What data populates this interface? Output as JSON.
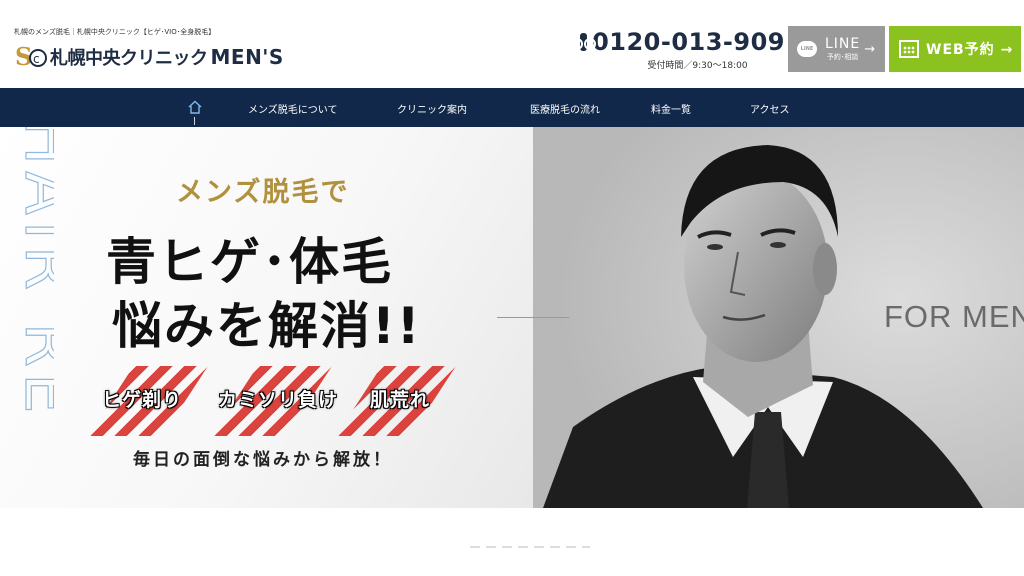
{
  "header": {
    "tagline": "札幌のメンズ脱毛｜札幌中央クリニック【ヒゲ･VIO･全身脱毛】",
    "logo_text": "札幌中央クリニック",
    "logo_suffix": "MEN'S",
    "phone_number": "0120-013-909",
    "phone_hours": "受付時間／9:30～18:00",
    "line_button": {
      "badge": "LINE",
      "label": "LINE",
      "sub": "予約･相談",
      "arrow": "→"
    },
    "web_button": {
      "label": "WEB予約",
      "arrow": "→"
    }
  },
  "nav": {
    "home_icon": "home-icon",
    "items": [
      {
        "label": "メンズ脱毛について"
      },
      {
        "label": "クリニック案内"
      },
      {
        "label": "医療脱毛の流れ"
      },
      {
        "label": "料金一覧"
      },
      {
        "label": "アクセス"
      }
    ]
  },
  "hero": {
    "subtitle": "メンズ脱毛で",
    "title_line1": "青ヒゲ･体毛",
    "title_line2": "悩みを解消!!",
    "troubles": [
      "ヒゲ剃り",
      "カミソリ負け",
      "肌荒れ"
    ],
    "note": "毎日の面倒な悩みから解放！",
    "for_men": "FOR MEN",
    "vertical_deco": "HAIR RE",
    "accent_colors": {
      "gold": "#b1913d",
      "stripe_red": "#d93a34",
      "nav_navy": "#11284a",
      "line_gray": "#9a9a9a",
      "web_green": "#8cc21f"
    }
  }
}
